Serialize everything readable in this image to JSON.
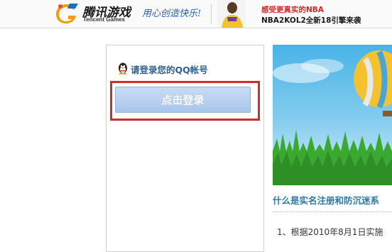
{
  "header": {
    "logo_cn": "腾讯游戏",
    "logo_en": "Tencent Games",
    "slogan": "用心创造快乐!",
    "promo_line1": "感受更真实的NBA",
    "promo_line2": "NBA2KOL2全新18引擎来袭"
  },
  "login": {
    "prompt": "请登录您的QQ帐号",
    "button_label": "点击登录"
  },
  "info": {
    "title": "什么是实名注册和防沉迷系",
    "body": "1、根据2010年8月1日实施"
  },
  "colors": {
    "highlight": "#c9302c",
    "link_blue": "#2b7aa6",
    "promo_red": "#d12a2a"
  }
}
